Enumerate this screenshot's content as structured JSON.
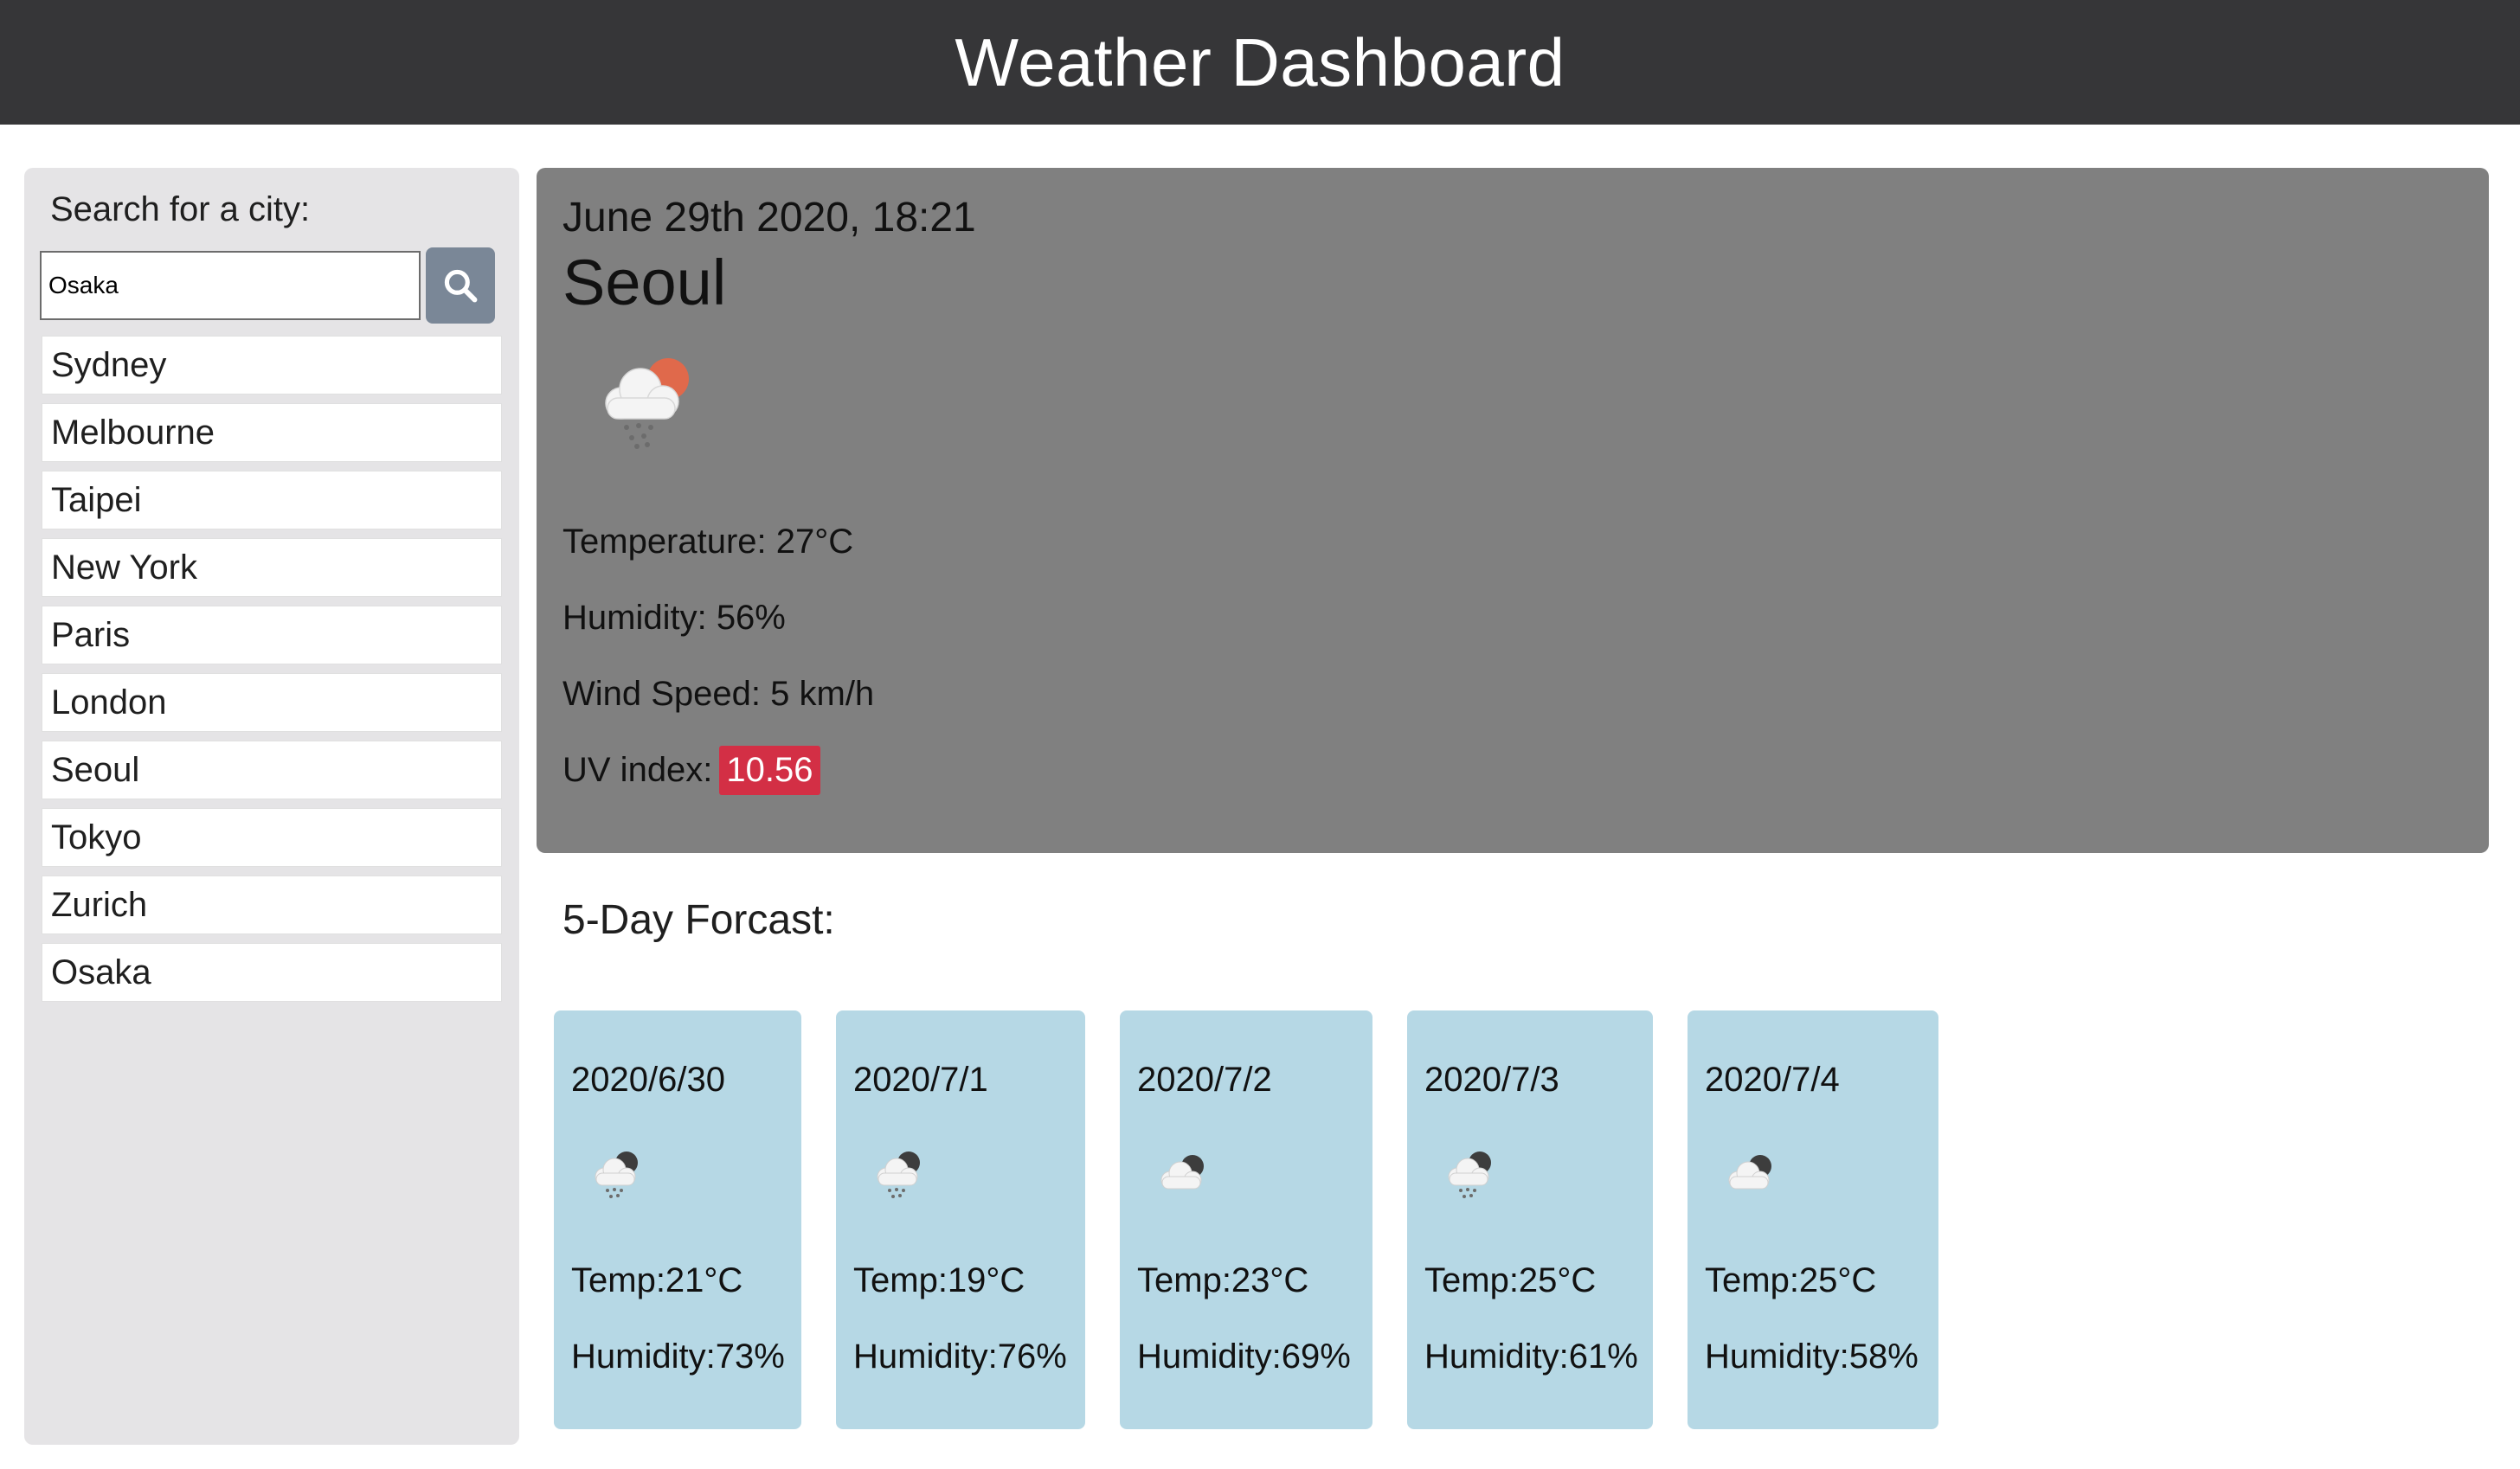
{
  "header": {
    "title": "Weather Dashboard"
  },
  "sidebar": {
    "search_label": "Search for a city:",
    "search_value": "Osaka",
    "cities": [
      "Sydney",
      "Melbourne",
      "Taipei",
      "New York",
      "Paris",
      "London",
      "Seoul",
      "Tokyo",
      "Zurich",
      "Osaka"
    ]
  },
  "current": {
    "datetime": "June 29th 2020, 18:21",
    "city": "Seoul",
    "icon": "cloud-rain-sun-icon",
    "temperature": "Temperature: 27°C",
    "humidity": "Humidity: 56%",
    "wind": "Wind Speed: 5 km/h",
    "uv_label": "UV index:",
    "uv_value": "10.56",
    "uv_color": "#d32f45"
  },
  "forecast": {
    "title": "5-Day Forcast:",
    "days": [
      {
        "date": "2020/6/30",
        "icon": "cloud-rain-moon-icon",
        "temp": "Temp:21°C",
        "humidity": "Humidity:73%"
      },
      {
        "date": "2020/7/1",
        "icon": "cloud-rain-moon-icon",
        "temp": "Temp:19°C",
        "humidity": "Humidity:76%"
      },
      {
        "date": "2020/7/2",
        "icon": "cloud-moon-icon",
        "temp": "Temp:23°C",
        "humidity": "Humidity:69%"
      },
      {
        "date": "2020/7/3",
        "icon": "cloud-rain-moon-icon",
        "temp": "Temp:25°C",
        "humidity": "Humidity:61%"
      },
      {
        "date": "2020/7/4",
        "icon": "cloud-moon-icon",
        "temp": "Temp:25°C",
        "humidity": "Humidity:58%"
      }
    ]
  },
  "colors": {
    "header_bg": "#363638",
    "sidebar_bg": "#e5e4e6",
    "current_bg": "#808080",
    "forecast_card_bg": "#b6d8e5",
    "search_button_bg": "#7a8797"
  }
}
